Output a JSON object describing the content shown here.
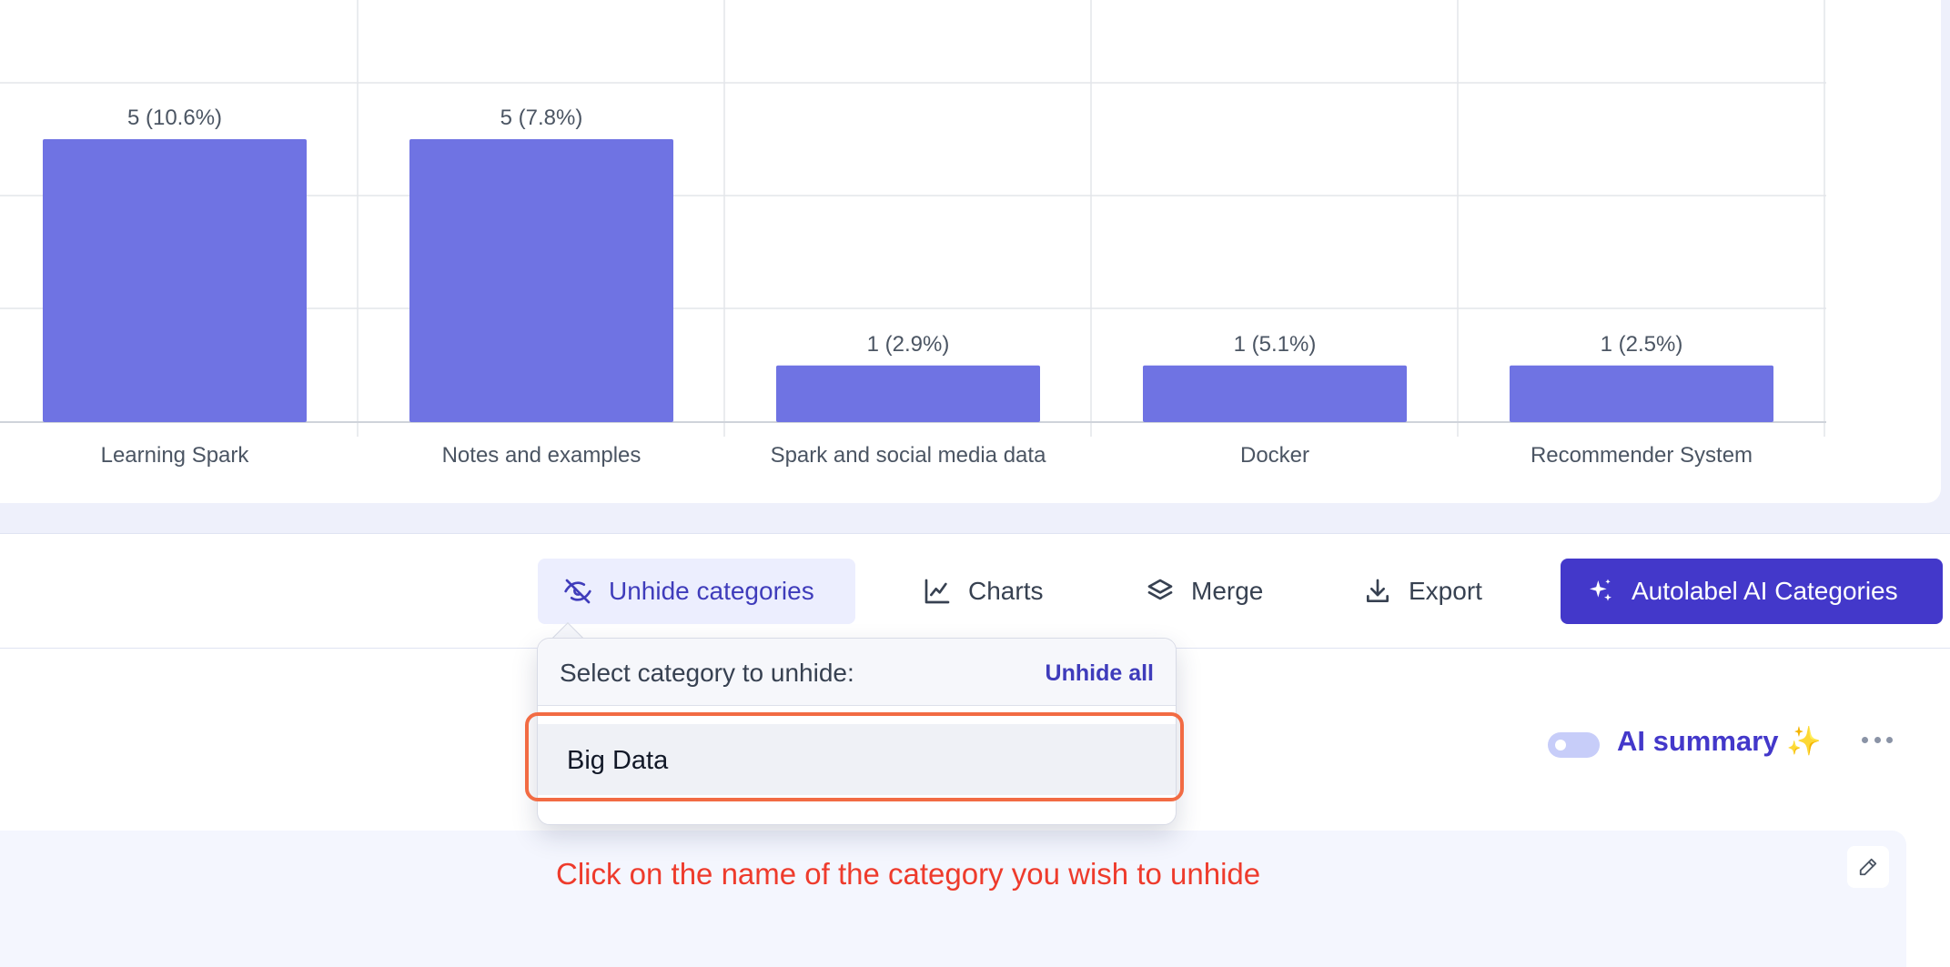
{
  "chart_data": {
    "type": "bar",
    "categories": [
      "Learning Spark",
      "Notes and examples",
      "Spark and social media data",
      "Docker",
      "Recommender System"
    ],
    "values": [
      5,
      5,
      1,
      1,
      1
    ],
    "data_labels": [
      "5 (10.6%)",
      "5 (7.8%)",
      "1 (2.9%)",
      "1 (5.1%)",
      "1 (2.5%)"
    ],
    "bar_color": "#6f73e3",
    "grid": true
  },
  "toolbar": {
    "unhide_label": "Unhide categories",
    "charts_label": "Charts",
    "merge_label": "Merge",
    "export_label": "Export",
    "autolabel_label": "Autolabel AI Categories"
  },
  "dropdown": {
    "title": "Select category to unhide:",
    "unhide_all_label": "Unhide all",
    "items": [
      {
        "label": "Big Data"
      }
    ]
  },
  "ai_summary": {
    "label": "AI summary",
    "sparkle": "✨",
    "enabled": false
  },
  "instruction": "Click on the name of the category you wish to unhide",
  "colors": {
    "accent": "#4338ca",
    "bar": "#6f73e3",
    "highlight": "#f26b43",
    "instruction": "#ee3b2c"
  }
}
